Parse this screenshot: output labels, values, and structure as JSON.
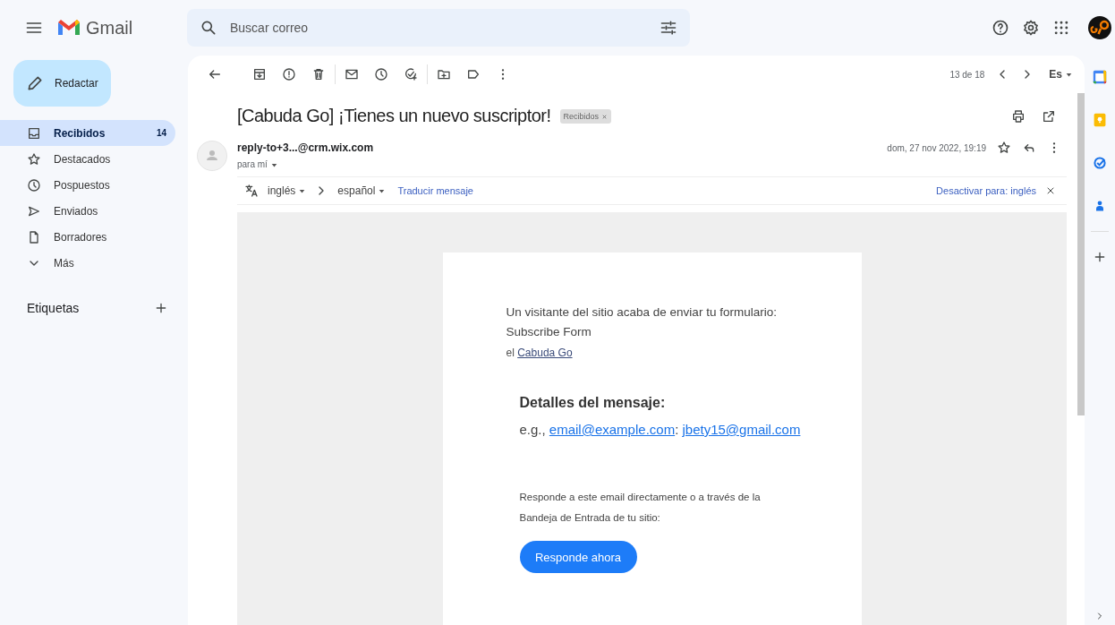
{
  "app": {
    "name": "Gmail"
  },
  "search": {
    "placeholder": "Buscar correo"
  },
  "compose": {
    "label": "Redactar"
  },
  "sidebar": {
    "items": [
      {
        "kind": "inbox",
        "label": "Recibidos",
        "count": "14",
        "selected": true
      },
      {
        "kind": "star",
        "label": "Destacados",
        "selected": false
      },
      {
        "kind": "clock",
        "label": "Pospuestos",
        "selected": false
      },
      {
        "kind": "send",
        "label": "Enviados",
        "selected": false
      },
      {
        "kind": "draft",
        "label": "Borradores",
        "selected": false
      },
      {
        "kind": "expand",
        "label": "Más",
        "selected": false
      }
    ],
    "labels_heading": "Etiquetas"
  },
  "toolbar": {
    "position": "13 de 18",
    "language": "Es"
  },
  "message": {
    "subject": "[Cabuda Go] ¡Tienes un nuevo suscriptor!",
    "label_chip": "Recibidos",
    "sender": "reply-to+3...@crm.wix.com",
    "recipient": "para mí",
    "date": "dom, 27 nov 2022, 19:19"
  },
  "translate": {
    "from": "inglés",
    "to": "español",
    "action": "Traducir mensaje",
    "disable": "Desactivar para: inglés"
  },
  "body": {
    "intro": "Un visitante del sitio acaba de enviar tu formulario:",
    "form_name": "Subscribe Form",
    "site_prefix": "el",
    "site_link": "Cabuda Go",
    "details_heading": "Detalles del mensaje:",
    "details": [
      {
        "text": "e.g., ",
        "link": false
      },
      {
        "text": "email@example.com",
        "link": true
      },
      {
        "text": ": ",
        "link": false
      },
      {
        "text": "jbety15@gmail.com",
        "link": true
      }
    ],
    "reply_note": "Responde a este email directamente o a través de la Bandeja de Entrada de tu sitio:",
    "reply_button": "Responde ahora"
  }
}
